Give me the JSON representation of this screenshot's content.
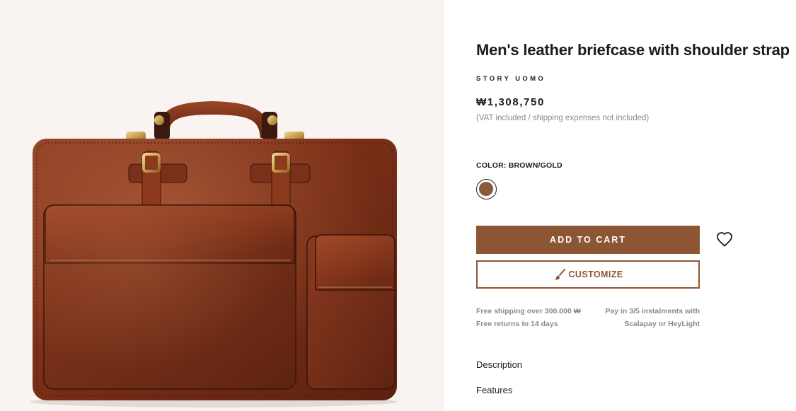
{
  "product": {
    "title": "Men's leather briefcase with shoulder strap",
    "brand": "STORY UOMO",
    "price": "₩1,308,750",
    "price_note": "(VAT included / shipping expenses not included)",
    "image_alt": "brown leather briefcase"
  },
  "color": {
    "label": "COLOR: BROWN/GOLD",
    "selected_swatch": "#8b5a3c"
  },
  "actions": {
    "add_to_cart": "ADD TO CART",
    "customize": "CUSTOMIZE",
    "wishlist_icon": "heart-icon",
    "customize_icon": "brush-icon"
  },
  "shipping": {
    "line1": "Free shipping over 300.000 ₩",
    "line2": "Free returns to 14 days",
    "pay_line1": "Pay in 3/5 instalments with",
    "pay_line2": "Scalapay or HeyLight"
  },
  "accordion": {
    "description": "Description",
    "features": "Features"
  },
  "colors": {
    "accent": "#8c5634",
    "image_bg": "#f9f4f1",
    "muted_text": "#8a8a8a"
  }
}
